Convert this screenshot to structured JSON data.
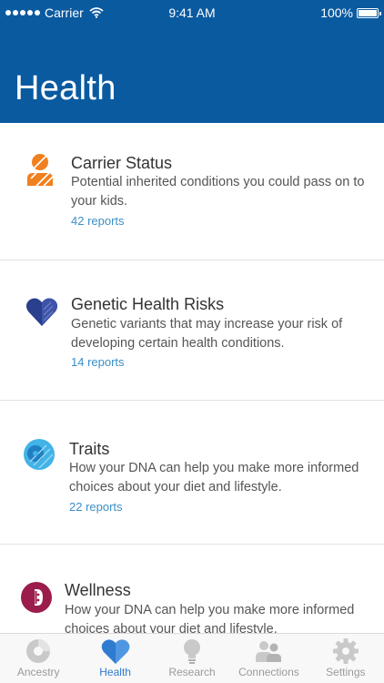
{
  "status_bar": {
    "carrier": "Carrier",
    "time": "9:41 AM",
    "battery": "100%"
  },
  "header": {
    "title": "Health",
    "background_color": "#0a5aa0"
  },
  "cards": [
    {
      "title": "Carrier Status",
      "description": "Potential inherited conditions you could pass on to your kids.",
      "link": "42 reports",
      "icon": "carrier-person-icon",
      "color": "#f07f1f"
    },
    {
      "title": "Genetic Health Risks",
      "description": "Genetic variants that may increase your risk of developing certain health conditions.",
      "link": "14 reports",
      "icon": "heart-icon",
      "color": "#2b3f8f"
    },
    {
      "title": "Traits",
      "description": "How your DNA can help you make more informed choices about your diet and lifestyle.",
      "link": "22 reports",
      "icon": "traits-circle-icon",
      "color": "#42b3e6"
    },
    {
      "title": "Wellness",
      "description": "How your DNA can help you make more informed choices about your diet and lifestyle.",
      "icon": "wellness-circle-icon",
      "color": "#9a1d4c"
    }
  ],
  "tabs": [
    {
      "label": "Ancestry",
      "icon": "ancestry-pie-icon",
      "active": false
    },
    {
      "label": "Health",
      "icon": "heart-icon",
      "active": true
    },
    {
      "label": "Research",
      "icon": "lightbulb-icon",
      "active": false
    },
    {
      "label": "Connections",
      "icon": "people-icon",
      "active": false
    },
    {
      "label": "Settings",
      "icon": "gear-icon",
      "active": false
    }
  ],
  "colors": {
    "link": "#3b8fc7",
    "tab_active": "#2f7bd0",
    "tab_inactive": "#9a9a9a"
  }
}
